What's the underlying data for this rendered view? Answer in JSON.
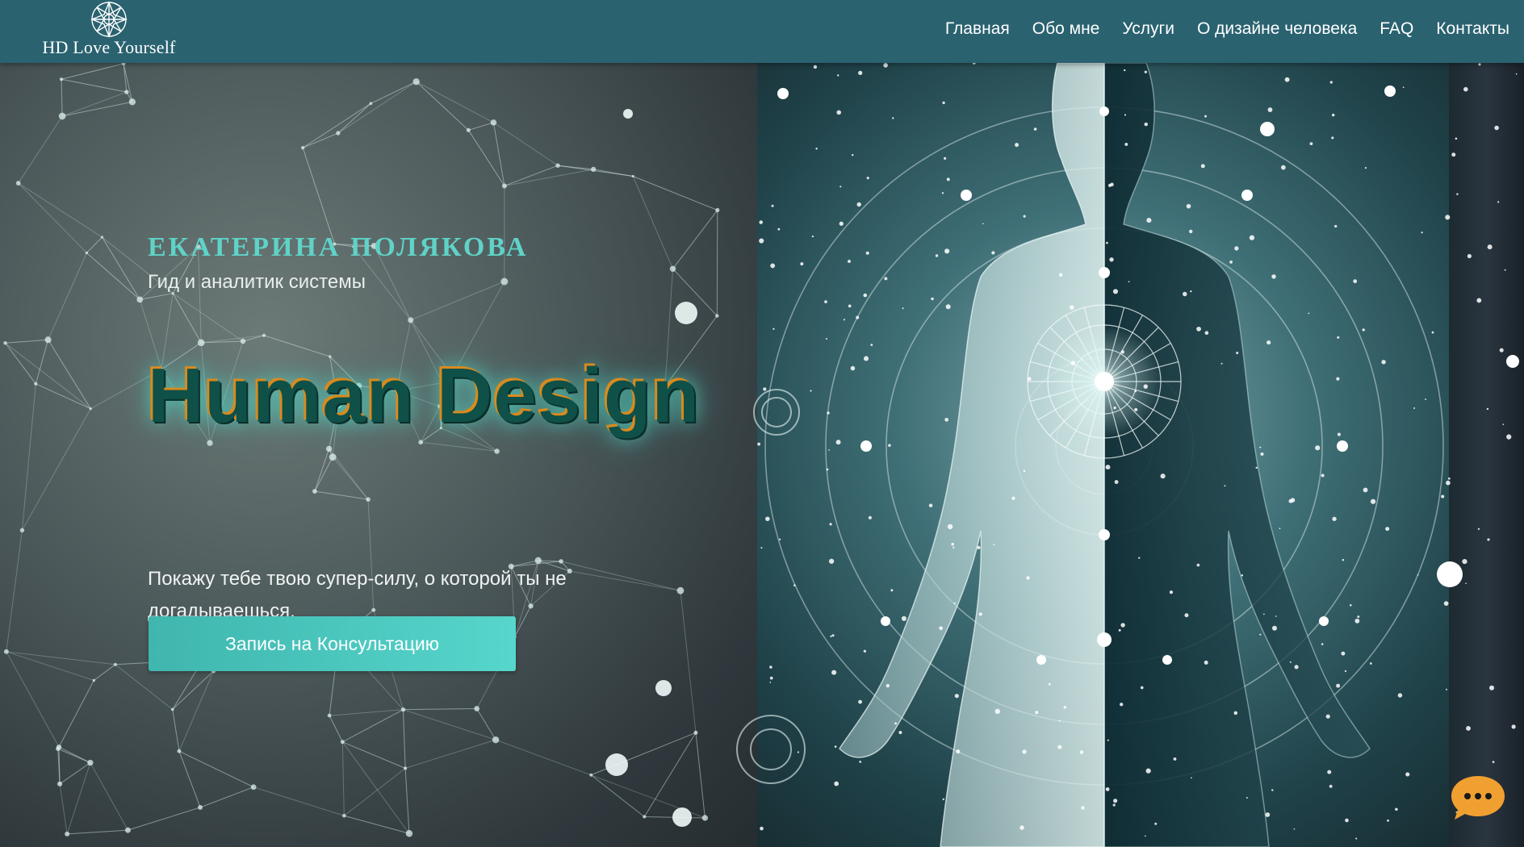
{
  "header": {
    "logo_text": "HD Love Yourself",
    "nav": [
      {
        "label": "Главная"
      },
      {
        "label": "Обо мне"
      },
      {
        "label": "Услуги"
      },
      {
        "label": "О дизайне человека"
      },
      {
        "label": "FAQ"
      },
      {
        "label": "Контакты"
      }
    ]
  },
  "hero": {
    "author_name": "ЕКАТЕРИНА ПОЛЯКОВА",
    "author_role": "Гид и аналитик системы",
    "headline": "Human Design",
    "tagline": "Покажу тебе твою супер-силу, о которой ты не догадываешься.",
    "cta_label": "Запись на Консультацию"
  },
  "chat": {
    "icon": "chat-bubble-icon"
  },
  "colors": {
    "header_bg": "#2a6270",
    "accent": "#5fd3c8",
    "cta_start": "#3fb6ae",
    "cta_end": "#56d6cc",
    "headline": "#0f5048",
    "chat_bg": "#f0a030"
  }
}
